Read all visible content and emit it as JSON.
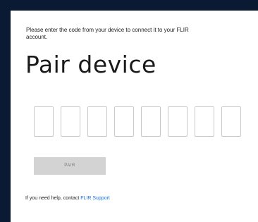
{
  "instructions": "Please enter the code from your device to connect it to your FLIR account.",
  "title": "Pair device",
  "code_fields": [
    "",
    "",
    "",
    "",
    "",
    "",
    "",
    ""
  ],
  "pair_button_label": "PAIR",
  "help": {
    "text": "If you need help, contact ",
    "link_label": "FLIR Support"
  }
}
